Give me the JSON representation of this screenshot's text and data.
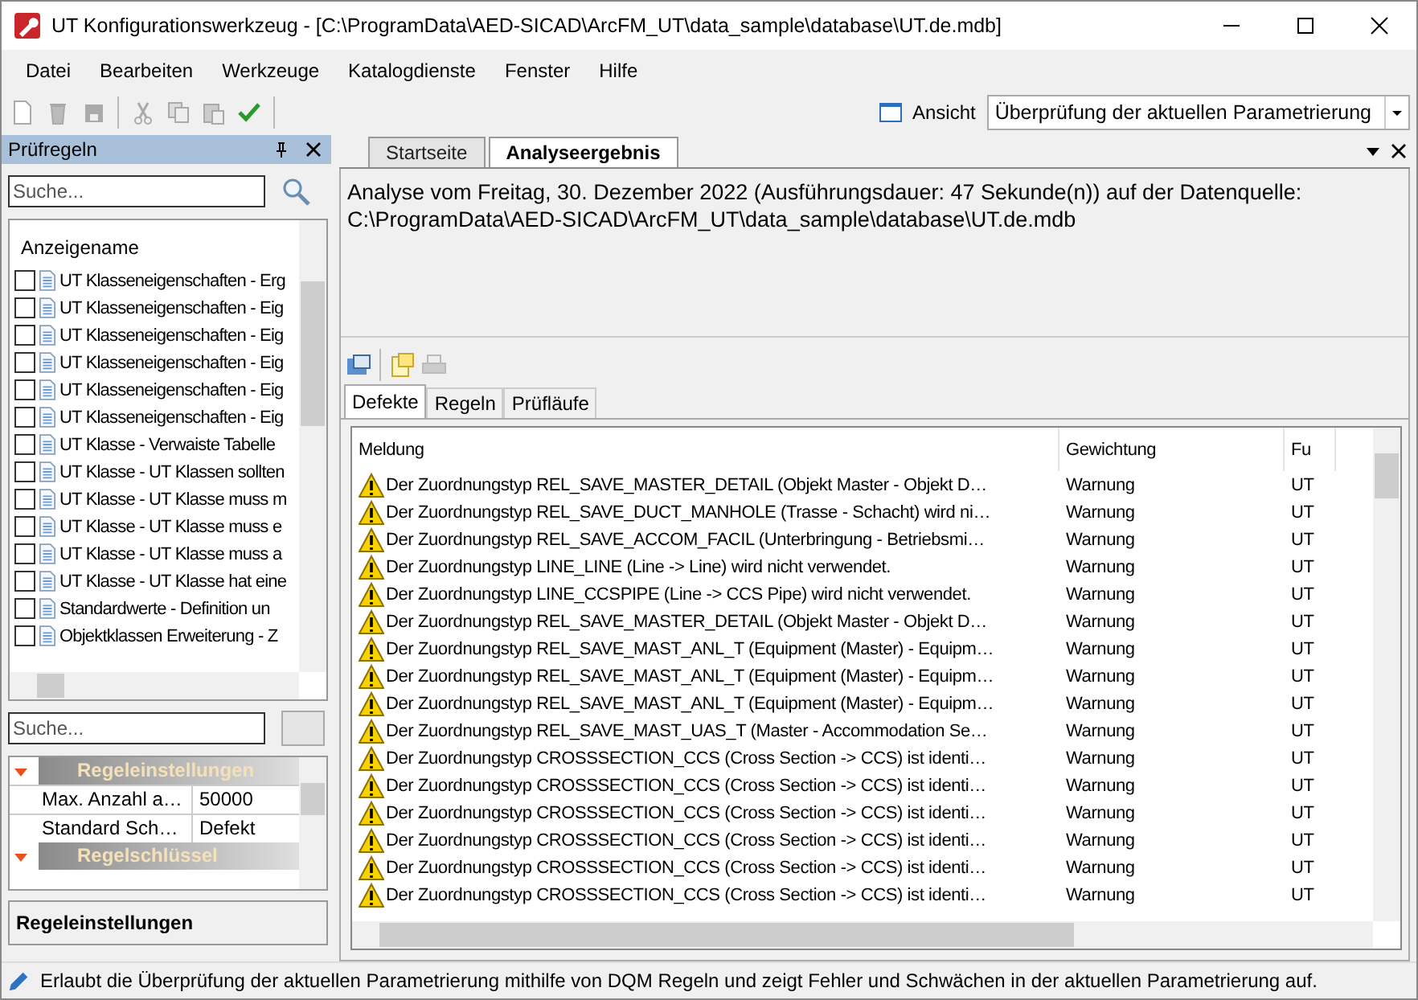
{
  "window": {
    "title": "UT Konfigurationswerkzeug - [C:\\ProgramData\\AED-SICAD\\ArcFM_UT\\data_sample\\database\\UT.de.mdb]"
  },
  "menu": [
    "Datei",
    "Bearbeiten",
    "Werkzeuge",
    "Katalogdienste",
    "Fenster",
    "Hilfe"
  ],
  "toolbar": {
    "view_label": "Ansicht",
    "view_value": "Überprüfung der aktuellen Parametrierung"
  },
  "rules_panel": {
    "title": "Prüfregeln",
    "search": {
      "placeholder": "Suche..."
    },
    "column": "Anzeigename",
    "items": [
      {
        "label": "UT Klasseneigenschaften - Erg",
        "checked": false
      },
      {
        "label": "UT Klasseneigenschaften - Eig",
        "checked": false
      },
      {
        "label": "UT Klasseneigenschaften - Eig",
        "checked": false
      },
      {
        "label": "UT Klasseneigenschaften - Eig",
        "checked": false
      },
      {
        "label": "UT Klasseneigenschaften - Eig",
        "checked": false
      },
      {
        "label": "UT Klasseneigenschaften - Eig",
        "checked": false
      },
      {
        "label": "UT Klasse - Verwaiste Tabelle",
        "checked": false
      },
      {
        "label": "UT Klasse - UT Klassen sollten",
        "checked": false
      },
      {
        "label": "UT Klasse - UT Klasse muss m",
        "checked": false
      },
      {
        "label": "UT Klasse - UT Klasse muss e",
        "checked": false
      },
      {
        "label": "UT Klasse - UT Klasse muss a",
        "checked": false
      },
      {
        "label": "UT Klasse - UT Klasse hat eine",
        "checked": false
      },
      {
        "label": "Standardwerte - Definition un",
        "checked": false
      },
      {
        "label": "Objektklassen Erweiterung - Z",
        "checked": false
      }
    ]
  },
  "properties": {
    "search": {
      "placeholder": "Suche..."
    },
    "categories": [
      {
        "title": "Regeleinstellungen",
        "expanded": true,
        "rows": [
          {
            "name": "Max. Anzahl a…",
            "value": "50000"
          },
          {
            "name": "Standard Sch…",
            "value": "Defekt"
          }
        ]
      },
      {
        "title": "Regelschlüssel",
        "expanded": true
      }
    ],
    "description_title": "Regeleinstellungen"
  },
  "doc_tabs": [
    {
      "label": "Startseite",
      "selected": false
    },
    {
      "label": "Analyseergebnis",
      "selected": true
    }
  ],
  "analysis_text": "Analyse vom Freitag, 30. Dezember 2022 (Ausführungsdauer: 47 Sekunde(n)) auf der Datenquelle: C:\\ProgramData\\AED-SICAD\\ArcFM_UT\\data_sample\\database\\UT.de.mdb",
  "result_tabs": [
    {
      "label": "Defekte",
      "selected": true
    },
    {
      "label": "Regeln",
      "selected": false
    },
    {
      "label": "Prüfläufe",
      "selected": false
    }
  ],
  "table": {
    "columns": [
      "Meldung",
      "Gewichtung",
      "Fu"
    ],
    "rows": [
      [
        "Der Zuordnungstyp REL_SAVE_MASTER_DETAIL (Objekt Master - Objekt D…",
        "Warnung",
        "UT"
      ],
      [
        "Der Zuordnungstyp REL_SAVE_DUCT_MANHOLE (Trasse - Schacht) wird ni…",
        "Warnung",
        "UT"
      ],
      [
        "Der Zuordnungstyp REL_SAVE_ACCOM_FACIL (Unterbringung - Betriebsmi…",
        "Warnung",
        "UT"
      ],
      [
        "Der Zuordnungstyp LINE_LINE (Line -> Line) wird nicht verwendet.",
        "Warnung",
        "UT"
      ],
      [
        "Der Zuordnungstyp LINE_CCSPIPE (Line -> CCS Pipe) wird nicht verwendet.",
        "Warnung",
        "UT"
      ],
      [
        "Der Zuordnungstyp REL_SAVE_MASTER_DETAIL (Objekt Master - Objekt D…",
        "Warnung",
        "UT"
      ],
      [
        "Der Zuordnungstyp REL_SAVE_MAST_ANL_T (Equipment (Master) - Equipm…",
        "Warnung",
        "UT"
      ],
      [
        "Der Zuordnungstyp REL_SAVE_MAST_ANL_T (Equipment (Master) - Equipm…",
        "Warnung",
        "UT"
      ],
      [
        "Der Zuordnungstyp REL_SAVE_MAST_ANL_T (Equipment (Master) - Equipm…",
        "Warnung",
        "UT"
      ],
      [
        "Der Zuordnungstyp REL_SAVE_MAST_UAS_T (Master - Accommodation Se…",
        "Warnung",
        "UT"
      ],
      [
        "Der Zuordnungstyp CROSSSECTION_CCS (Cross Section -> CCS) ist identi…",
        "Warnung",
        "UT"
      ],
      [
        "Der Zuordnungstyp CROSSSECTION_CCS (Cross Section -> CCS) ist identi…",
        "Warnung",
        "UT"
      ],
      [
        "Der Zuordnungstyp CROSSSECTION_CCS (Cross Section -> CCS) ist identi…",
        "Warnung",
        "UT"
      ],
      [
        "Der Zuordnungstyp CROSSSECTION_CCS (Cross Section -> CCS) ist identi…",
        "Warnung",
        "UT"
      ],
      [
        "Der Zuordnungstyp CROSSSECTION_CCS (Cross Section -> CCS) ist identi…",
        "Warnung",
        "UT"
      ],
      [
        "Der Zuordnungstyp CROSSSECTION_CCS (Cross Section -> CCS) ist identi…",
        "Warnung",
        "UT"
      ]
    ]
  },
  "status_bar": "Erlaubt die Überprüfung der aktuellen Parametrierung mithilfe von DQM Regeln und zeigt Fehler und Schwächen in der aktuellen Parametrierung auf."
}
